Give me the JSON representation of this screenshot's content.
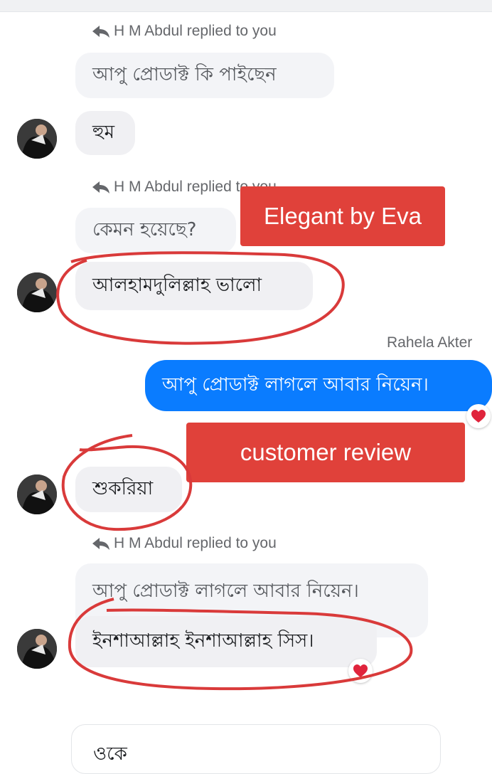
{
  "colors": {
    "accent": "#0a7cff",
    "label_bg": "#e0413a",
    "annotation": "#d93a3a",
    "bubble": "#f0f0f3"
  },
  "messages": [
    {
      "reply_header": "H M Abdul replied to you",
      "quoted": "আপু প্রোডাক্ট কি পাইছেন",
      "reply": "হুম"
    },
    {
      "reply_header": "H M Abdul replied to you",
      "quoted": "কেমন হয়েছে?",
      "reply": "আলহামদুলিল্লাহ ভালো"
    },
    {
      "sender": "Rahela Akter",
      "text": "আপু প্রোডাক্ট লাগলে আবার নিয়েন।",
      "reaction": "heart-icon"
    },
    {
      "reply": "শুকরিয়া"
    },
    {
      "reply_header": "H M Abdul replied to you",
      "quoted": "আপু প্রোডাক্ট লাগলে আবার নিয়েন।",
      "reply": "ইনশাআল্লাহ ইনশাআল্লাহ সিস।",
      "reaction": "heart-icon"
    }
  ],
  "labels": {
    "brand": "Elegant by Eva",
    "review": "customer review"
  },
  "composer": {
    "text": "ওকে"
  }
}
